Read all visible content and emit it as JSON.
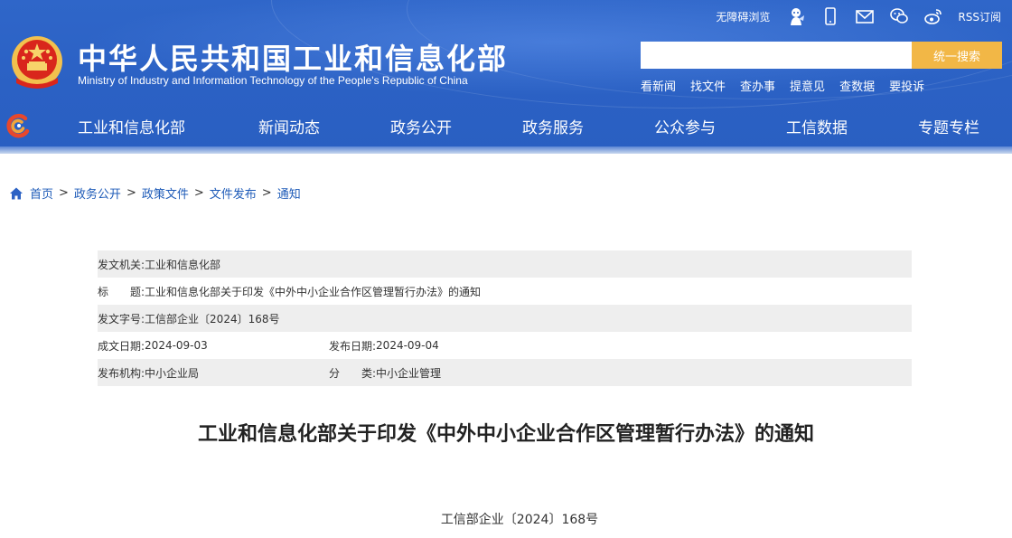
{
  "header": {
    "utils": {
      "accessible_label": "无障碍浏览",
      "rss_label": "RSS订阅",
      "icons": [
        "robot-icon",
        "mobile-icon",
        "mail-icon",
        "wechat-icon",
        "weibo-icon"
      ]
    },
    "title": "中华人民共和国工业和信息化部",
    "subtitle": "Ministry of Industry and Information Technology of the People's Republic of China",
    "search": {
      "placeholder": "",
      "button_label": "统一搜索"
    },
    "quick_links": [
      "看新闻",
      "找文件",
      "查办事",
      "提意见",
      "查数据",
      "要投诉"
    ],
    "colors": {
      "header_blue": "#2b61c4",
      "search_button": "#f2b746",
      "link_blue": "#1e5bb8"
    }
  },
  "nav": {
    "items": [
      "工业和信息化部",
      "新闻动态",
      "政务公开",
      "政务服务",
      "公众参与",
      "工信数据",
      "专题专栏"
    ]
  },
  "breadcrumb": {
    "items": [
      "首页",
      "政务公开",
      "政策文件",
      "文件发布",
      "通知"
    ],
    "separator": ">"
  },
  "info": {
    "issuer_label": "发文机关:",
    "issuer": "工业和信息化部",
    "title_label": "标　　题:",
    "title": "工业和信息化部关于印发《中外中小企业合作区管理暂行办法》的通知",
    "doc_no_label": "发文字号:",
    "doc_no": "工信部企业〔2024〕168号",
    "created_label": "成文日期:",
    "created": "2024-09-03",
    "published_label": "发布日期:",
    "published": "2024-09-04",
    "org_label": "发布机构:",
    "org": "中小企业局",
    "category_label": "分　　类:",
    "category": "中小企业管理"
  },
  "article": {
    "title": "工业和信息化部关于印发《中外中小企业合作区管理暂行办法》的通知",
    "doc_number": "工信部企业〔2024〕168号"
  }
}
